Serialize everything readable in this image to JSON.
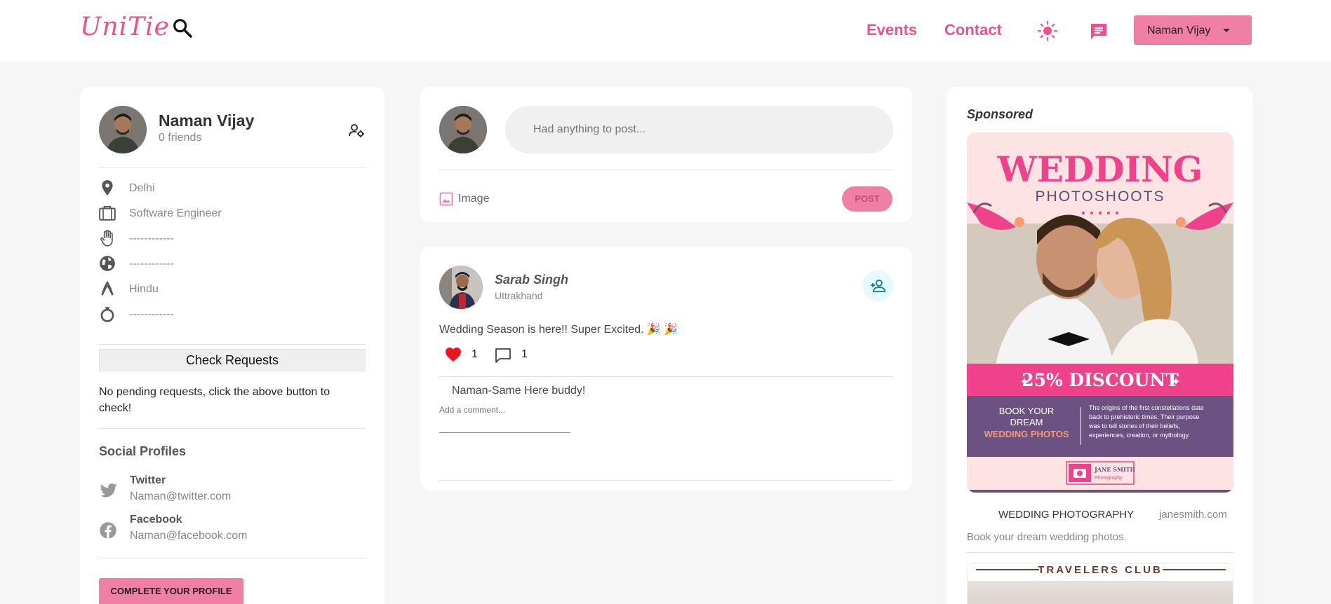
{
  "navbar": {
    "logo": "UniTie",
    "links": {
      "events": "Events",
      "contact": "Contact"
    },
    "user_select": "Naman Vijay",
    "icons": [
      "search-icon",
      "sun-icon",
      "message-icon",
      "chevron-down-icon"
    ],
    "accent_color": "#f0508a"
  },
  "profile": {
    "name": "Naman Vijay",
    "friends": "0 friends",
    "info": [
      {
        "icon": "location-icon",
        "text": "Delhi"
      },
      {
        "icon": "briefcase-icon",
        "text": "Software Engineer"
      },
      {
        "icon": "hand-icon",
        "text": "------------"
      },
      {
        "icon": "globe-icon",
        "text": "------------"
      },
      {
        "icon": "pray-icon",
        "text": "Hindu"
      },
      {
        "icon": "ring-icon",
        "text": "------------"
      }
    ],
    "check_requests": "Check Requests",
    "no_requests": "No pending requests, click the above button to check!",
    "social_title": "Social Profiles",
    "socials": [
      {
        "network": "Twitter",
        "account": "Naman@twitter.com"
      },
      {
        "network": "Facebook",
        "account": "Naman@facebook.com"
      }
    ],
    "complete_button": "COMPLETE YOUR PROFILE"
  },
  "create_post": {
    "placeholder": "Had anything to post...",
    "image_label": "Image",
    "post_button": "POST"
  },
  "post": {
    "author": "Sarab Singh",
    "location": "Uttrakhand",
    "text": "Wedding Season is here!! Super Excited. 🎉 🎉",
    "likes": "1",
    "comments": "1",
    "comment_list": [
      "Naman-Same Here buddy!"
    ],
    "add_comment_placeholder": "Add a comment..."
  },
  "sponsored": {
    "title": "Sponsored",
    "ad_image_text": {
      "headline": "WEDDING",
      "subhead": "PHOTOSHOOTS",
      "discount": "25% DISCOUNT",
      "book_line1": "BOOK YOUR",
      "book_line2": "DREAM",
      "book_line3": "WEDDING PHOTOS",
      "blurb": [
        "The origins of the first constellations date",
        "back to prehistoric times. Their purpose",
        "was to tell stories of their beliefs,",
        "experiences, creation, or mythology."
      ],
      "logo_name": "JANE SMITH",
      "logo_sub": "Photography"
    },
    "ad_name": "WEDDING PHOTOGRAPHY",
    "ad_site": "janesmith.com",
    "ad_desc": "Book your dream wedding photos.",
    "second_ad_title": "TRAVELERS CLUB"
  }
}
